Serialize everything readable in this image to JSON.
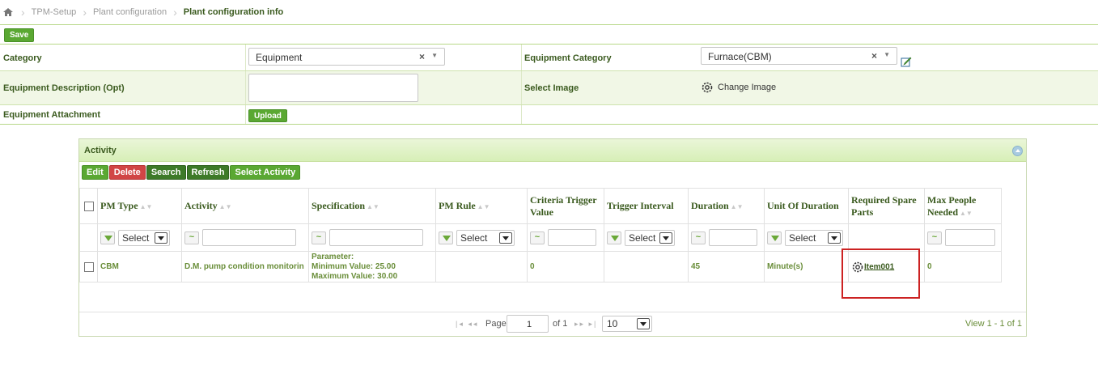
{
  "breadcrumb": {
    "items": [
      "TPM-Setup",
      "Plant configuration",
      "Plant configuration info"
    ]
  },
  "toolbar": {
    "save_label": "Save"
  },
  "form": {
    "category_label": "Category",
    "category_value": "Equipment",
    "equipment_category_label": "Equipment Category",
    "equipment_category_value": "Furnace(CBM)",
    "description_label": "Equipment Description (Opt)",
    "select_image_label": "Select Image",
    "change_image_label": "Change Image",
    "attachment_label": "Equipment Attachment",
    "upload_label": "Upload"
  },
  "activity": {
    "title": "Activity",
    "buttons": {
      "edit": "Edit",
      "delete": "Delete",
      "search": "Search",
      "refresh": "Refresh",
      "select_activity": "Select Activity"
    },
    "columns": [
      "PM Type",
      "Activity",
      "Specification",
      "PM Rule",
      "Criteria Trigger Value",
      "Trigger Interval",
      "Duration",
      "Unit Of Duration",
      "Required Spare Parts",
      "Max People Needed"
    ],
    "filter_select": "Select",
    "rows": [
      {
        "pm_type": "CBM",
        "activity": "D.M. pump condition monitorin",
        "spec_line1": "Parameter:",
        "spec_line2": "Minimum Value: 25.00",
        "spec_line3": "Maximum Value: 30.00",
        "pm_rule": "",
        "criteria_trigger_value": "0",
        "trigger_interval": "",
        "duration": "45",
        "unit_of_duration": "Minute(s)",
        "required_spare_parts": "Item001",
        "max_people_needed": "0"
      }
    ],
    "pager": {
      "page_label": "Page",
      "page": "1",
      "of_label": "of 1",
      "page_size": "10",
      "view_text": "View 1 - 1 of 1"
    }
  },
  "colors": {
    "accent_green": "#5aa832",
    "delete_red": "#d14545",
    "label_green": "#3a5a1e",
    "highlight_red": "#cc2222"
  },
  "icons": [
    "home-icon",
    "edit-icon",
    "gear-icon",
    "collapse-icon",
    "funnel-icon"
  ]
}
